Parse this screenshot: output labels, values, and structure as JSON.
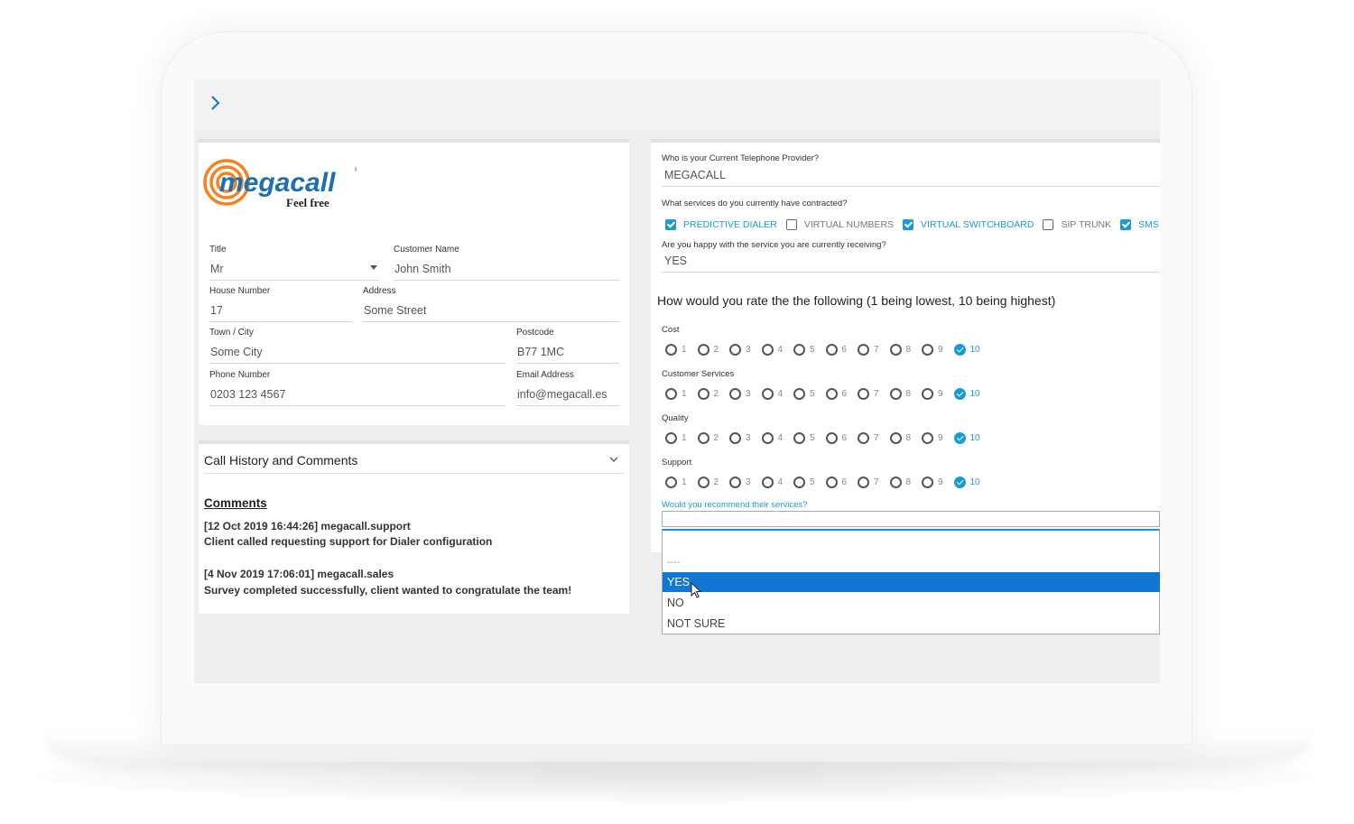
{
  "brand": {
    "name": "megacall",
    "tagline": "Feel free",
    "accent_color": "#1a9ad6",
    "logo_color": "#f58220",
    "selected_color": "#1078d4"
  },
  "contact": {
    "title_label": "Title",
    "title_value": "Mr",
    "customer_name_label": "Customer Name",
    "customer_name_value": "John Smith",
    "house_number_label": "House Number",
    "house_number_value": "17",
    "address_label": "Address",
    "address_value": "Some Street",
    "town_label": "Town / City",
    "town_value": "Some City",
    "postcode_label": "Postcode",
    "postcode_value": "B77 1MC",
    "phone_label": "Phone Number",
    "phone_value": "0203 123 4567",
    "email_label": "Email Address",
    "email_value": "info@megacall.es"
  },
  "history": {
    "title": "Call History and Comments",
    "comments_heading": "Comments",
    "entries": [
      {
        "header": "[12 Oct 2019 16:44:26] megacall.support",
        "text": "Client called requesting support for Dialer configuration"
      },
      {
        "header": "[4 Nov 2019 17:06:01] megacall.sales",
        "text": "Survey completed successfully, client wanted to congratulate the team!"
      }
    ]
  },
  "survey": {
    "provider_label": "Who is your Current Telephone Provider?",
    "provider_value": "MEGACALL",
    "services_label": "What services do you currently have contracted?",
    "services": [
      {
        "label": "PREDICTIVE DIALER",
        "checked": true
      },
      {
        "label": "VIRTUAL NUMBERS",
        "checked": false
      },
      {
        "label": "VIRTUAL SWITCHBOARD",
        "checked": true
      },
      {
        "label": "SIP TRUNK",
        "checked": false
      },
      {
        "label": "SMS",
        "checked": true
      }
    ],
    "happy_label": "Are you happy with the service you are currently receiving?",
    "happy_value": "YES",
    "rating_title": "How would you rate the the following (1 being lowest, 10 being highest)",
    "ratings": [
      {
        "label": "Cost",
        "selected": 10
      },
      {
        "label": "Customer Services",
        "selected": 10
      },
      {
        "label": "Quality",
        "selected": 10
      },
      {
        "label": "Support",
        "selected": 10
      }
    ],
    "scale": [
      "1",
      "2",
      "3",
      "4",
      "5",
      "6",
      "7",
      "8",
      "9",
      "10"
    ],
    "recommend_label": "Would you recommend their services?",
    "recommend_options": [
      "----",
      "YES",
      "NO",
      "NOT SURE"
    ],
    "recommend_highlighted": "YES"
  }
}
